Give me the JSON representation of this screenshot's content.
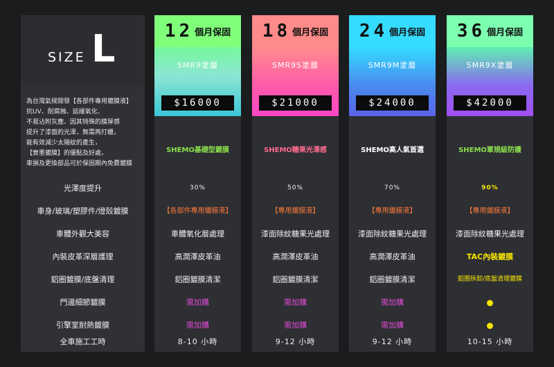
{
  "left": {
    "size_word": "SIZE",
    "size_letter": "L",
    "description": "為台灣氣候開發【各部件專用鍍膜液】\n抗UV、耐腐蝕、延緩氧化、\n不易沾附灰塵、因其特殊的膜厚感\n提升了漆面的光澤，無需再打蠟，\n能有效減少太陽紋的產生，\n【實墨鍍膜】的優點及好處，\n車損及更換部品可於保固期內免費鍍膜",
    "row_labels": [
      "光澤度提升",
      "車身/玻璃/塑膠件/燈殼鍍膜",
      "車體外觀大美容",
      "內裝皮革深層護理",
      "鋁圈鍍膜/底盤清理",
      "門邊細節鍍膜",
      "引擎室耐熱鍍膜",
      "全車施工工時"
    ]
  },
  "plans": [
    {
      "warranty_num": "12",
      "warranty_unit": "個月保固",
      "coating": "SMR9塗層",
      "price": "$16000",
      "slogan": "SHEMO基礎型鍍膜",
      "cells": [
        "30%",
        "【各部件專用鍍膜液】",
        "車體氧化層處理",
        "高潤澤皮革油",
        "鋁圈鍍膜清潔",
        "需加購",
        "需加購",
        "8-10 小時"
      ]
    },
    {
      "warranty_num": "18",
      "warranty_unit": "個月保固",
      "coating": "SMR9S塗層",
      "price": "$21000",
      "slogan": "SHEMO糖果光澤感",
      "cells": [
        "50%",
        "【專用鍍膜液】",
        "漆面除紋糖果光處理",
        "高潤澤皮革油",
        "鋁圈鍍膜清潔",
        "需加購",
        "需加購",
        "9-12 小時"
      ]
    },
    {
      "warranty_num": "24",
      "warranty_unit": "個月保固",
      "coating": "SMR9M塗層",
      "price": "$24000",
      "slogan": "SHEMO高人氣首選",
      "cells": [
        "70%",
        "【專用鍍膜液】",
        "漆面除紋糖果光處理",
        "高潤澤皮革油",
        "鋁圈鍍膜清潔",
        "需加購",
        "需加購",
        "9-12 小時"
      ]
    },
    {
      "warranty_num": "36",
      "warranty_unit": "個月保固",
      "coating": "SMR9X塗層",
      "price": "$42000",
      "slogan": "SHEMO軍規級防護",
      "cells": [
        "90%",
        "【專用鍍膜液】",
        "漆面除紋糖果光處理",
        "TAC內裝鍍膜",
        "鋁圈拆卸/底盤清理鍍膜",
        "",
        "",
        "10-15 小時"
      ]
    }
  ],
  "colors": {
    "plan1_head": "#7fff7a",
    "plan2_head": "#ff8a8a",
    "plan3_head": "#35dcff",
    "plan4_head": "#7dffb0",
    "orange_text": "#ff7a3a",
    "pink_text": "#e24bd6",
    "yellow_text": "#f7e400"
  }
}
